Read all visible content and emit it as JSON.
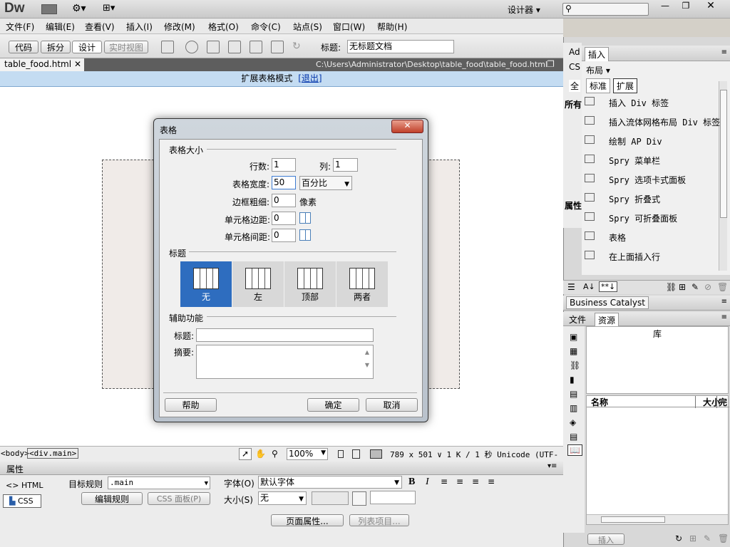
{
  "app": {
    "logo": "Dw",
    "workspace": "设计器",
    "search_placeholder": ""
  },
  "menu": [
    "文件(F)",
    "编辑(E)",
    "查看(V)",
    "插入(I)",
    "修改(M)",
    "格式(O)",
    "命令(C)",
    "站点(S)",
    "窗口(W)",
    "帮助(H)"
  ],
  "doc_toolbar": {
    "code": "代码",
    "split": "拆分",
    "design": "设计",
    "live": "实时视图",
    "title_label": "标题:",
    "title_value": "无标题文档"
  },
  "tab": {
    "file": "table_food.html",
    "path": "C:\\Users\\Administrator\\Desktop\\table_food\\table_food.html"
  },
  "expanded_bar": {
    "text": "扩展表格模式",
    "exit": "[退出]"
  },
  "dialog": {
    "title": "表格",
    "section_size": "表格大小",
    "rows_label": "行数:",
    "rows_value": "1",
    "cols_label": "列:",
    "cols_value": "1",
    "width_label": "表格宽度:",
    "width_value": "50",
    "width_unit": "百分比",
    "border_label": "边框粗细:",
    "border_value": "0",
    "border_unit": "像素",
    "padding_label": "单元格边距:",
    "padding_value": "0",
    "spacing_label": "单元格间距:",
    "spacing_value": "0",
    "section_header": "标题",
    "header_options": [
      "无",
      "左",
      "顶部",
      "两者"
    ],
    "section_access": "辅助功能",
    "caption_label": "标题:",
    "caption_value": "",
    "summary_label": "摘要:",
    "summary_value": "",
    "help": "帮助",
    "ok": "确定",
    "cancel": "取消"
  },
  "status": {
    "tag_body": "<body>",
    "tag_div": "<div.main>",
    "zoom": "100%",
    "info": "789 x 501 ∨ 1 K / 1 秒 Unicode (UTF-8)"
  },
  "properties": {
    "title": "属性",
    "html": "HTML",
    "css": "CSS",
    "rule_label": "目标规则",
    "rule_value": ".main",
    "edit_rule": "编辑规则",
    "css_panel": "CSS 面板(P)",
    "font_label": "字体(O)",
    "font_value": "默认字体",
    "size_label": "大小(S)",
    "size_value": "无",
    "page_props": "页面属性...",
    "list_item": "列表项目..."
  },
  "right": {
    "ad": "Ad",
    "cs": "CS",
    "all": "全",
    "all2": "所有",
    "attr": "属性",
    "insert_tab": "插入",
    "layout": "布局",
    "std": "标准",
    "ext": "扩展",
    "items": [
      "插入 Div 标签",
      "插入流体网格布局 Div 标签",
      "绘制 AP Div",
      "Spry 菜单栏",
      "Spry 选项卡式面板",
      "Spry 折叠式",
      "Spry 可折叠面板",
      "表格",
      "在上面插入行"
    ],
    "bc": "Business Catalyst",
    "files_tab": "文件",
    "assets_tab": "资源",
    "library": "库",
    "col_name": "名称",
    "col_size": "大小",
    "col_full": "完",
    "insert_btn": "插入"
  }
}
